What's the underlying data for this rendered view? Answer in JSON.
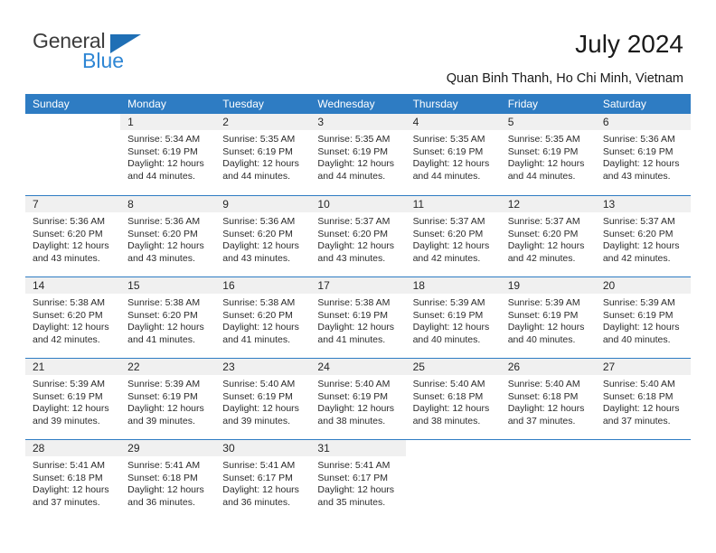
{
  "logo": {
    "word1": "General",
    "word2": "Blue",
    "triangle_color": "#1f6fb5",
    "blue_color": "#2e86d4"
  },
  "header": {
    "title": "July 2024",
    "subtitle": "Quan Binh Thanh, Ho Chi Minh, Vietnam"
  },
  "theme": {
    "header_blue": "#2e7cc3",
    "daynum_band": "#f0f0f0",
    "text": "#2b2b2b"
  },
  "calendar": {
    "weekdays": [
      "Sunday",
      "Monday",
      "Tuesday",
      "Wednesday",
      "Thursday",
      "Friday",
      "Saturday"
    ],
    "weeks": [
      [
        {
          "day": "",
          "sunrise": "",
          "sunset": "",
          "daylight_line1": "",
          "daylight_line2": ""
        },
        {
          "day": "1",
          "sunrise": "Sunrise: 5:34 AM",
          "sunset": "Sunset: 6:19 PM",
          "daylight_line1": "Daylight: 12 hours",
          "daylight_line2": "and 44 minutes."
        },
        {
          "day": "2",
          "sunrise": "Sunrise: 5:35 AM",
          "sunset": "Sunset: 6:19 PM",
          "daylight_line1": "Daylight: 12 hours",
          "daylight_line2": "and 44 minutes."
        },
        {
          "day": "3",
          "sunrise": "Sunrise: 5:35 AM",
          "sunset": "Sunset: 6:19 PM",
          "daylight_line1": "Daylight: 12 hours",
          "daylight_line2": "and 44 minutes."
        },
        {
          "day": "4",
          "sunrise": "Sunrise: 5:35 AM",
          "sunset": "Sunset: 6:19 PM",
          "daylight_line1": "Daylight: 12 hours",
          "daylight_line2": "and 44 minutes."
        },
        {
          "day": "5",
          "sunrise": "Sunrise: 5:35 AM",
          "sunset": "Sunset: 6:19 PM",
          "daylight_line1": "Daylight: 12 hours",
          "daylight_line2": "and 44 minutes."
        },
        {
          "day": "6",
          "sunrise": "Sunrise: 5:36 AM",
          "sunset": "Sunset: 6:19 PM",
          "daylight_line1": "Daylight: 12 hours",
          "daylight_line2": "and 43 minutes."
        }
      ],
      [
        {
          "day": "7",
          "sunrise": "Sunrise: 5:36 AM",
          "sunset": "Sunset: 6:20 PM",
          "daylight_line1": "Daylight: 12 hours",
          "daylight_line2": "and 43 minutes."
        },
        {
          "day": "8",
          "sunrise": "Sunrise: 5:36 AM",
          "sunset": "Sunset: 6:20 PM",
          "daylight_line1": "Daylight: 12 hours",
          "daylight_line2": "and 43 minutes."
        },
        {
          "day": "9",
          "sunrise": "Sunrise: 5:36 AM",
          "sunset": "Sunset: 6:20 PM",
          "daylight_line1": "Daylight: 12 hours",
          "daylight_line2": "and 43 minutes."
        },
        {
          "day": "10",
          "sunrise": "Sunrise: 5:37 AM",
          "sunset": "Sunset: 6:20 PM",
          "daylight_line1": "Daylight: 12 hours",
          "daylight_line2": "and 43 minutes."
        },
        {
          "day": "11",
          "sunrise": "Sunrise: 5:37 AM",
          "sunset": "Sunset: 6:20 PM",
          "daylight_line1": "Daylight: 12 hours",
          "daylight_line2": "and 42 minutes."
        },
        {
          "day": "12",
          "sunrise": "Sunrise: 5:37 AM",
          "sunset": "Sunset: 6:20 PM",
          "daylight_line1": "Daylight: 12 hours",
          "daylight_line2": "and 42 minutes."
        },
        {
          "day": "13",
          "sunrise": "Sunrise: 5:37 AM",
          "sunset": "Sunset: 6:20 PM",
          "daylight_line1": "Daylight: 12 hours",
          "daylight_line2": "and 42 minutes."
        }
      ],
      [
        {
          "day": "14",
          "sunrise": "Sunrise: 5:38 AM",
          "sunset": "Sunset: 6:20 PM",
          "daylight_line1": "Daylight: 12 hours",
          "daylight_line2": "and 42 minutes."
        },
        {
          "day": "15",
          "sunrise": "Sunrise: 5:38 AM",
          "sunset": "Sunset: 6:20 PM",
          "daylight_line1": "Daylight: 12 hours",
          "daylight_line2": "and 41 minutes."
        },
        {
          "day": "16",
          "sunrise": "Sunrise: 5:38 AM",
          "sunset": "Sunset: 6:20 PM",
          "daylight_line1": "Daylight: 12 hours",
          "daylight_line2": "and 41 minutes."
        },
        {
          "day": "17",
          "sunrise": "Sunrise: 5:38 AM",
          "sunset": "Sunset: 6:19 PM",
          "daylight_line1": "Daylight: 12 hours",
          "daylight_line2": "and 41 minutes."
        },
        {
          "day": "18",
          "sunrise": "Sunrise: 5:39 AM",
          "sunset": "Sunset: 6:19 PM",
          "daylight_line1": "Daylight: 12 hours",
          "daylight_line2": "and 40 minutes."
        },
        {
          "day": "19",
          "sunrise": "Sunrise: 5:39 AM",
          "sunset": "Sunset: 6:19 PM",
          "daylight_line1": "Daylight: 12 hours",
          "daylight_line2": "and 40 minutes."
        },
        {
          "day": "20",
          "sunrise": "Sunrise: 5:39 AM",
          "sunset": "Sunset: 6:19 PM",
          "daylight_line1": "Daylight: 12 hours",
          "daylight_line2": "and 40 minutes."
        }
      ],
      [
        {
          "day": "21",
          "sunrise": "Sunrise: 5:39 AM",
          "sunset": "Sunset: 6:19 PM",
          "daylight_line1": "Daylight: 12 hours",
          "daylight_line2": "and 39 minutes."
        },
        {
          "day": "22",
          "sunrise": "Sunrise: 5:39 AM",
          "sunset": "Sunset: 6:19 PM",
          "daylight_line1": "Daylight: 12 hours",
          "daylight_line2": "and 39 minutes."
        },
        {
          "day": "23",
          "sunrise": "Sunrise: 5:40 AM",
          "sunset": "Sunset: 6:19 PM",
          "daylight_line1": "Daylight: 12 hours",
          "daylight_line2": "and 39 minutes."
        },
        {
          "day": "24",
          "sunrise": "Sunrise: 5:40 AM",
          "sunset": "Sunset: 6:19 PM",
          "daylight_line1": "Daylight: 12 hours",
          "daylight_line2": "and 38 minutes."
        },
        {
          "day": "25",
          "sunrise": "Sunrise: 5:40 AM",
          "sunset": "Sunset: 6:18 PM",
          "daylight_line1": "Daylight: 12 hours",
          "daylight_line2": "and 38 minutes."
        },
        {
          "day": "26",
          "sunrise": "Sunrise: 5:40 AM",
          "sunset": "Sunset: 6:18 PM",
          "daylight_line1": "Daylight: 12 hours",
          "daylight_line2": "and 37 minutes."
        },
        {
          "day": "27",
          "sunrise": "Sunrise: 5:40 AM",
          "sunset": "Sunset: 6:18 PM",
          "daylight_line1": "Daylight: 12 hours",
          "daylight_line2": "and 37 minutes."
        }
      ],
      [
        {
          "day": "28",
          "sunrise": "Sunrise: 5:41 AM",
          "sunset": "Sunset: 6:18 PM",
          "daylight_line1": "Daylight: 12 hours",
          "daylight_line2": "and 37 minutes."
        },
        {
          "day": "29",
          "sunrise": "Sunrise: 5:41 AM",
          "sunset": "Sunset: 6:18 PM",
          "daylight_line1": "Daylight: 12 hours",
          "daylight_line2": "and 36 minutes."
        },
        {
          "day": "30",
          "sunrise": "Sunrise: 5:41 AM",
          "sunset": "Sunset: 6:17 PM",
          "daylight_line1": "Daylight: 12 hours",
          "daylight_line2": "and 36 minutes."
        },
        {
          "day": "31",
          "sunrise": "Sunrise: 5:41 AM",
          "sunset": "Sunset: 6:17 PM",
          "daylight_line1": "Daylight: 12 hours",
          "daylight_line2": "and 35 minutes."
        },
        {
          "day": "",
          "sunrise": "",
          "sunset": "",
          "daylight_line1": "",
          "daylight_line2": ""
        },
        {
          "day": "",
          "sunrise": "",
          "sunset": "",
          "daylight_line1": "",
          "daylight_line2": ""
        },
        {
          "day": "",
          "sunrise": "",
          "sunset": "",
          "daylight_line1": "",
          "daylight_line2": ""
        }
      ]
    ]
  }
}
